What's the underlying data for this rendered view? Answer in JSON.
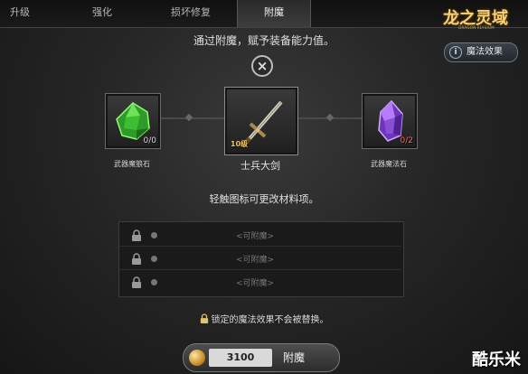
{
  "tabs": [
    {
      "label": "升级"
    },
    {
      "label": "强化"
    },
    {
      "label": "损坏修复"
    },
    {
      "label": "附魔",
      "active": true
    }
  ],
  "logo": {
    "title": "龙之灵域",
    "subtitle": "DRAGON ELYSIUM"
  },
  "magic_effect_button": {
    "label": "魔法效果"
  },
  "headline": "通过附魔，赋予装备能力值。",
  "left_slot": {
    "caption": "武器魔狼石",
    "count": "0/0",
    "icon": "green-gem-icon"
  },
  "weapon_slot": {
    "name": "士兵大剑",
    "level": "10级",
    "icon": "sword-icon"
  },
  "right_slot": {
    "caption": "武器魔法石",
    "count": "0/2",
    "icon": "purple-crystal-icon"
  },
  "hint": "轻触图标可更改材料项。",
  "enchant_rows": [
    {
      "text": "<可附魔>"
    },
    {
      "text": "<可附魔>"
    },
    {
      "text": "<可附魔>"
    }
  ],
  "lock_note": "锁定的魔法效果不会被替换。",
  "enchant_button": {
    "cost": "3100",
    "label": "附魔"
  },
  "watermark": "酷乐米",
  "colors": {
    "accent_gold": "#f4d27a",
    "count_red": "#ff6565"
  }
}
